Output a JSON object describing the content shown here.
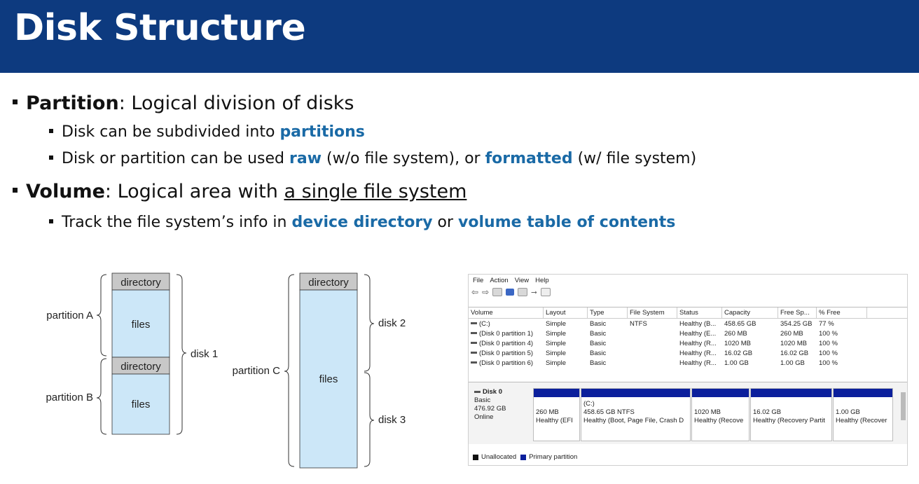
{
  "slide": {
    "title": "Disk Structure",
    "bullets": {
      "partition_term": "Partition",
      "partition_desc": ": Logical division of disks",
      "sub1_pre": "Disk can be subdivided into ",
      "sub1_hl": "partitions",
      "sub2_pre": "Disk or partition can be used ",
      "sub2_raw": "raw",
      "sub2_mid": " (w/o file system), or ",
      "sub2_fmt": "formatted",
      "sub2_post": " (w/ file system)",
      "volume_term": "Volume",
      "volume_pre": ": Logical area with ",
      "volume_u": "a single file system",
      "sub3_pre": "Track the file system’s info in ",
      "sub3_hl1": "device directory",
      "sub3_mid": " or ",
      "sub3_hl2": "volume table of contents"
    }
  },
  "diagram": {
    "directory": "directory",
    "files": "files",
    "partition_a": "partition A",
    "partition_b": "partition B",
    "partition_c": "partition C",
    "disk1": "disk 1",
    "disk2": "disk 2",
    "disk3": "disk 3"
  },
  "disk_management": {
    "menu": [
      "File",
      "Action",
      "View",
      "Help"
    ],
    "columns": [
      "Volume",
      "Layout",
      "Type",
      "File System",
      "Status",
      "Capacity",
      "Free Sp...",
      "% Free"
    ],
    "rows": [
      [
        "(C:)",
        "Simple",
        "Basic",
        "NTFS",
        "Healthy (B...",
        "458.65 GB",
        "354.25 GB",
        "77 %"
      ],
      [
        "(Disk 0 partition 1)",
        "Simple",
        "Basic",
        "",
        "Healthy (E...",
        "260 MB",
        "260 MB",
        "100 %"
      ],
      [
        "(Disk 0 partition 4)",
        "Simple",
        "Basic",
        "",
        "Healthy (R...",
        "1020 MB",
        "1020 MB",
        "100 %"
      ],
      [
        "(Disk 0 partition 5)",
        "Simple",
        "Basic",
        "",
        "Healthy (R...",
        "16.02 GB",
        "16.02 GB",
        "100 %"
      ],
      [
        "(Disk 0 partition 6)",
        "Simple",
        "Basic",
        "",
        "Healthy (R...",
        "1.00 GB",
        "1.00 GB",
        "100 %"
      ]
    ],
    "disk": {
      "name": "Disk 0",
      "type": "Basic",
      "size": "476.92 GB",
      "status": "Online"
    },
    "partitions": [
      {
        "name": "",
        "size": "260 MB",
        "status": "Healthy (EFI"
      },
      {
        "name": "(C:)",
        "size": "458.65 GB NTFS",
        "status": "Healthy (Boot, Page File, Crash D"
      },
      {
        "name": "",
        "size": "1020 MB",
        "status": "Healthy (Recove"
      },
      {
        "name": "",
        "size": "16.02 GB",
        "status": "Healthy (Recovery Partit"
      },
      {
        "name": "",
        "size": "1.00 GB",
        "status": "Healthy (Recover"
      }
    ],
    "legend": {
      "unallocated": "Unallocated",
      "primary": "Primary partition"
    },
    "colors": {
      "primary": "#0b1f9c",
      "unallocated": "#111111",
      "header": "#0d3a7f",
      "highlight": "#1a6aa6",
      "files_fill": "#cce7f8",
      "directory_fill": "#c8c8c8"
    }
  }
}
